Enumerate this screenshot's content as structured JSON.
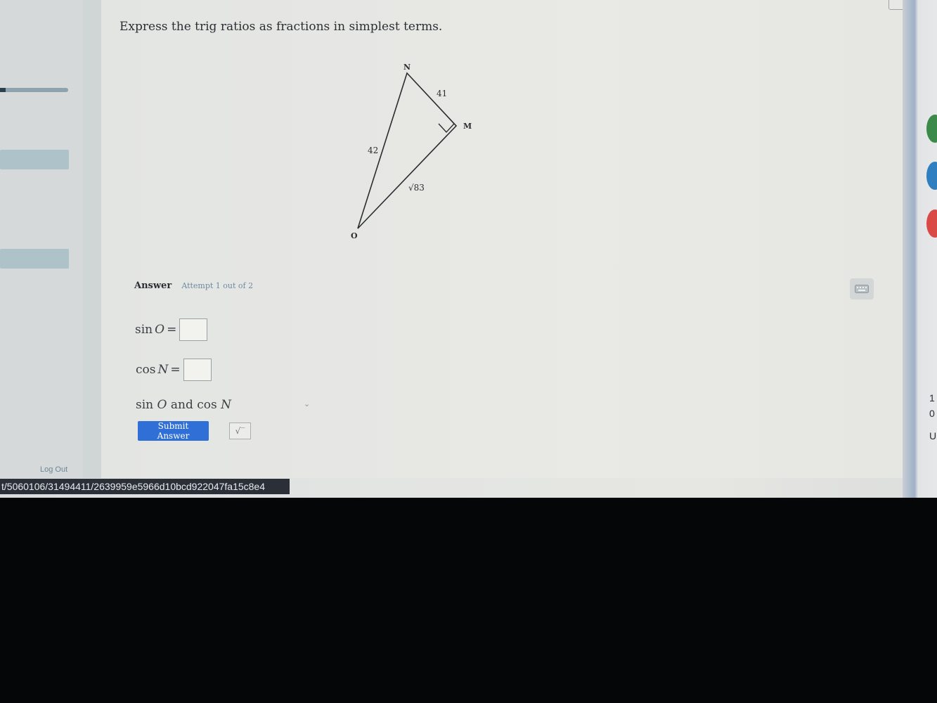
{
  "question": "Express the trig ratios as fractions in simplest terms.",
  "figure": {
    "vertices": {
      "top": "N",
      "right": "M",
      "bottom": "O"
    },
    "side_labels": {
      "NM": "41",
      "NO": "42",
      "MO": "√83"
    },
    "right_angle_at": "M"
  },
  "answer": {
    "label": "Answer",
    "attempt": "Attempt 1 out of 2"
  },
  "equations": {
    "eq1": {
      "func": "sin",
      "var": "O",
      "op": "="
    },
    "eq2": {
      "func": "cos",
      "var": "N",
      "op": "="
    },
    "eq3": {
      "func1": "sin",
      "var1": "O",
      "conj": "and",
      "func2": "cos",
      "var2": "N"
    }
  },
  "buttons": {
    "submit": "Submit Answer",
    "sqrt": "√‾"
  },
  "sidebar": {
    "logout": "Log Out"
  },
  "url": "t/5060106/31494411/2639959e5966d10bcd922047fa15c8e4",
  "right_panel": {
    "t1": "1",
    "t2": "0",
    "t3": "U"
  },
  "colors": {
    "submit": "#2f6fd6",
    "accent_link": "#6f8aa0",
    "url_bar": "#2b3038"
  },
  "icons": [
    "keyboard-icon",
    "sqrt-icon",
    "chevron-down-icon"
  ]
}
